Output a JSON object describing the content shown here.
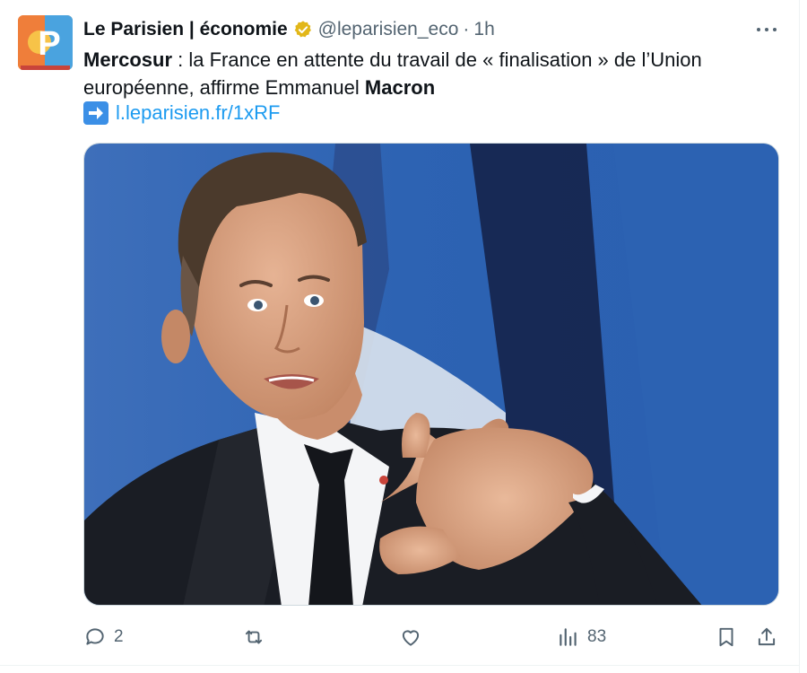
{
  "tweet": {
    "display_name": "Le Parisien | économie",
    "handle": "@leparisien_eco",
    "separator": "·",
    "time": "1h",
    "text_bold_1": "Mercosur",
    "text_part_1": " : la France en attente du travail de « finalisation » de l’Union européenne, affirme Emmanuel ",
    "text_bold_2": "Macron",
    "link_text": "l.leparisien.fr/1xRF",
    "avatar_letter": "P"
  },
  "actions": {
    "reply_count": "2",
    "retweet_count": "",
    "like_count": "",
    "views_count": "83"
  },
  "icons": {
    "verified": "verified-badge-icon",
    "more": "more-icon",
    "arrow": "right-arrow-emoji",
    "reply": "reply-icon",
    "retweet": "retweet-icon",
    "like": "heart-icon",
    "views": "views-icon",
    "bookmark": "bookmark-icon",
    "share": "share-icon"
  },
  "colors": {
    "link": "#1d9bf0",
    "muted": "#536471",
    "verified_gold": "#e2b719",
    "avatar_orange": "#f08a3c",
    "avatar_blue": "#4aa3df"
  }
}
